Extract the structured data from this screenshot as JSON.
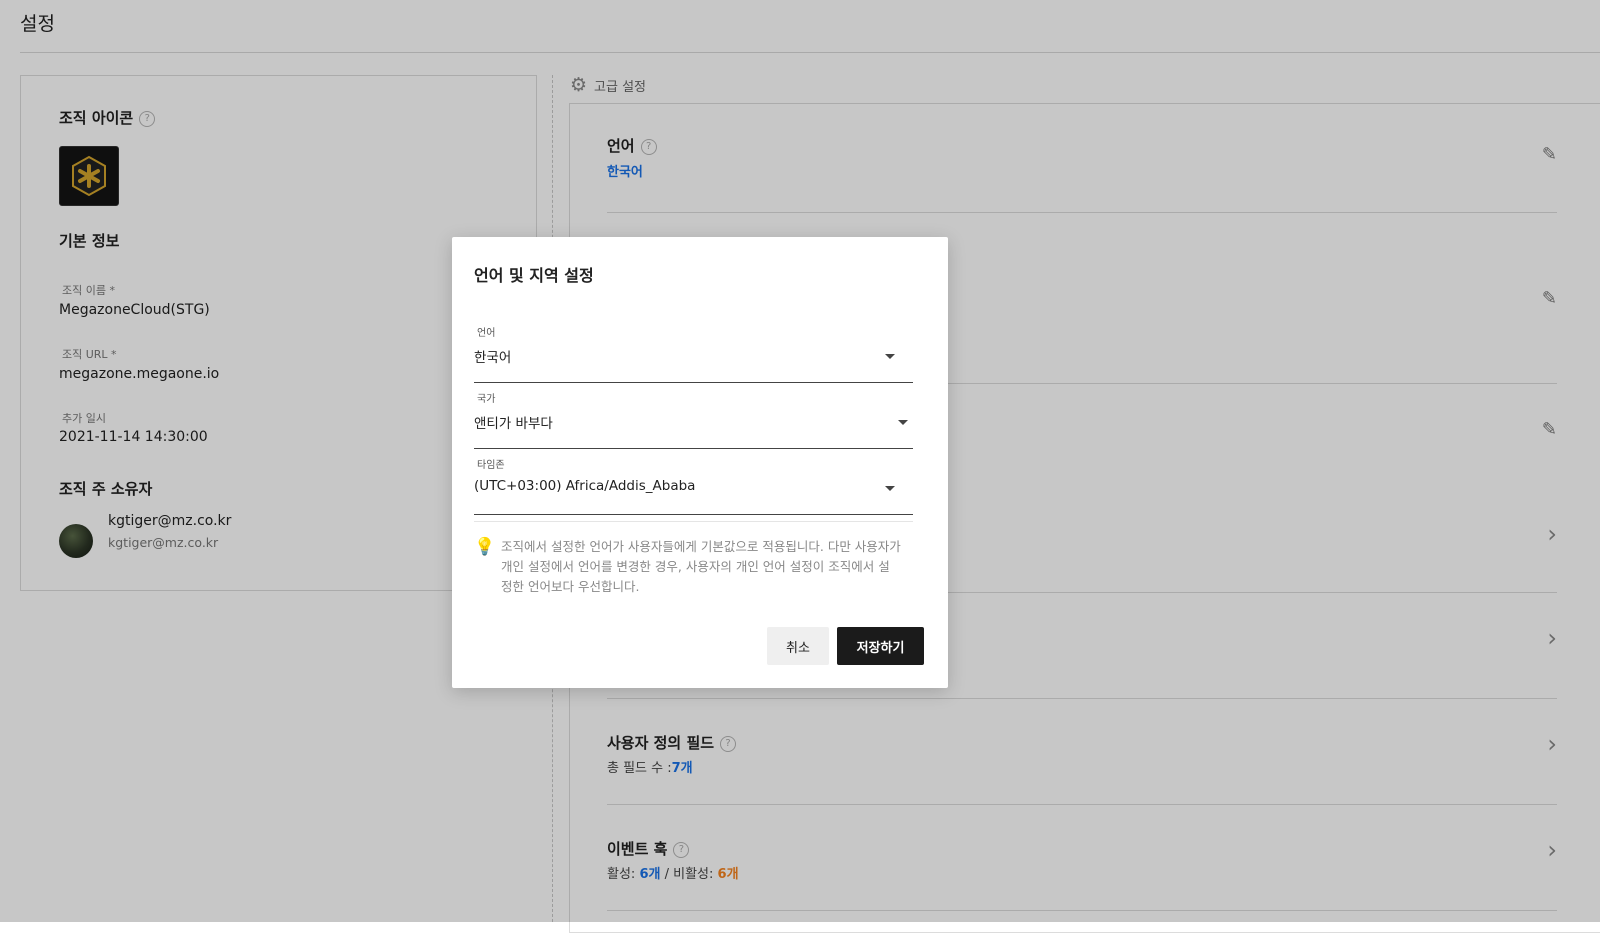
{
  "page": {
    "title": "설정"
  },
  "left": {
    "org_icon_title": "조직 아이콘",
    "basic_info_title": "기본 정보",
    "fields": [
      {
        "label": "조직 이름 *",
        "value": "MegazoneCloud(STG)"
      },
      {
        "label": "조직 URL *",
        "value": "megazone.megaone.io"
      },
      {
        "label": "추가 일시",
        "value": "2021-11-14 14:30:00"
      }
    ],
    "owner_title": "조직 주 소유자",
    "owner": {
      "name": "kgtiger@mz.co.kr",
      "email": "kgtiger@mz.co.kr"
    }
  },
  "advanced": {
    "header": "고급 설정",
    "language": {
      "title": "언어",
      "value": "한국어"
    },
    "custom_fields": {
      "title": "사용자 정의 필드",
      "count_label": "총 필드 수 :",
      "count_value": "7개"
    },
    "event_hook": {
      "title": "이벤트 훅",
      "active_label": "활성:",
      "active_value": "6개",
      "separator": "/",
      "inactive_label": "비활성:",
      "inactive_value": "6개"
    }
  },
  "modal": {
    "title": "언어 및 지역 설정",
    "language": {
      "label": "언어",
      "value": "한국어"
    },
    "country": {
      "label": "국가",
      "value": "앤티가 바부다"
    },
    "timezone": {
      "label": "타임존",
      "value": "(UTC+03:00) Africa/Addis_Ababa"
    },
    "hint": "조직에서 설정한 언어가 사용자들에게 기본값으로 적용됩니다. 다만 사용자가 개인 설정에서 언어를 변경한 경우, 사용자의 개인 언어 설정이 조직에서 설정한 언어보다 우선합니다.",
    "cancel": "취소",
    "save": "저장하기"
  },
  "colors": {
    "accent_blue": "#1a73e8",
    "accent_orange": "#f5831f",
    "primary_button": "#1b1b1b"
  },
  "icons": [
    "help-icon",
    "gear-icon",
    "edit-icon",
    "chevron-right-icon",
    "dropdown-caret-icon",
    "lightbulb-icon"
  ]
}
